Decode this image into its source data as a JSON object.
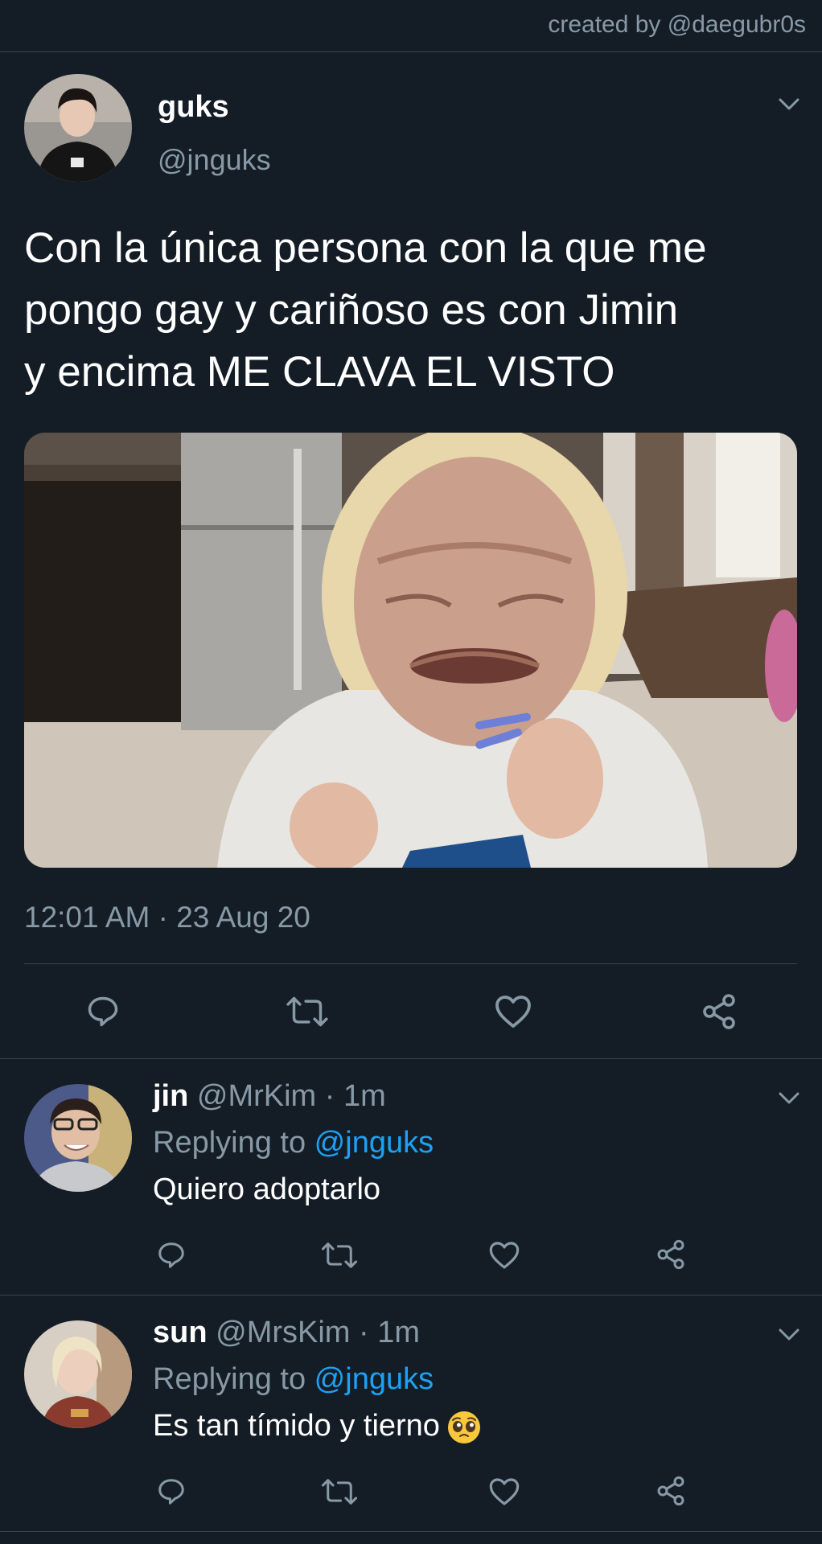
{
  "watermark": "created by @daegubr0s",
  "main_tweet": {
    "name": "guks",
    "handle": "@jnguks",
    "text": "Con la única persona con la que me\npongo gay y cariñoso es con Jimin\ny encima ME CLAVA EL VISTO",
    "timestamp": "12:01 AM · 23 Aug 20"
  },
  "replies": [
    {
      "name": "jin",
      "meta": " @MrKim · 1m",
      "replying_prefix": "Replying to ",
      "replying_handle": "@jnguks",
      "text": "Quiero adoptarlo"
    },
    {
      "name": "sun",
      "meta": " @MrsKim · 1m",
      "replying_prefix": "Replying to ",
      "replying_handle": "@jnguks",
      "text": "Es tan tímido y tierno",
      "emoji": "pleading-face"
    }
  ],
  "icons": [
    "reply-icon",
    "retweet-icon",
    "like-icon",
    "share-icon",
    "chevron-down-icon"
  ],
  "colors": {
    "background": "#141d26",
    "muted": "#8899a6",
    "link": "#1da1f2",
    "divider": "#38444d"
  }
}
